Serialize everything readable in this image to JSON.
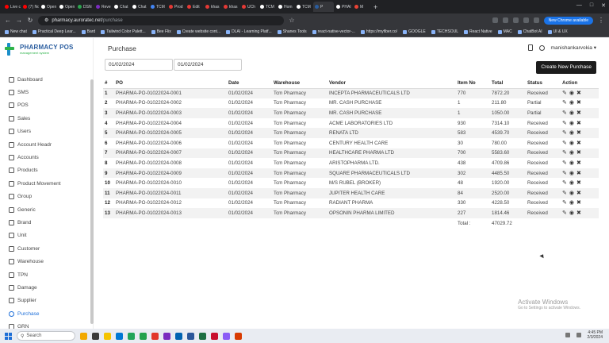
{
  "browser": {
    "tabs": [
      {
        "label": "Live ci",
        "color": "#ff0000"
      },
      {
        "label": "(7) No",
        "color": "#ff0000"
      },
      {
        "label": "Open",
        "color": "#ffffff"
      },
      {
        "label": "Open",
        "color": "#ffffff"
      },
      {
        "label": "DSN",
        "color": "#2da44e"
      },
      {
        "label": "Reve",
        "color": "#7b2cbf"
      },
      {
        "label": "Chat",
        "color": "#ffffff"
      },
      {
        "label": "Chat",
        "color": "#ffffff"
      },
      {
        "label": "TCM",
        "color": "#4285f4"
      },
      {
        "label": "Prod",
        "color": "#e53935"
      },
      {
        "label": "Edit",
        "color": "#e53935"
      },
      {
        "label": "khas",
        "color": "#e53935"
      },
      {
        "label": "khas",
        "color": "#e53935"
      },
      {
        "label": "UCh",
        "color": "#e53935"
      },
      {
        "label": "TCM",
        "color": "#ffffff"
      },
      {
        "label": "Hom",
        "color": "#ffffff"
      },
      {
        "label": "TCM",
        "color": "#ffffff"
      },
      {
        "label": "P",
        "color": "#2a5d9f",
        "active": true
      },
      {
        "label": "PHAI",
        "color": "#ffffff"
      },
      {
        "label": "M",
        "color": "#ea4335"
      }
    ],
    "url_host": "pharmacy.auroratec.net",
    "url_path": "/purchase",
    "new_chrome": "New Chrome available",
    "bookmarks": [
      "New chat",
      "Practical Deep Lear...",
      "Bard",
      "Tailwind Color Palett...",
      "Bee Flix",
      "Create website cont...",
      "DLAI - Learning Platf...",
      "Shanes Tools",
      "react-native-vector-...",
      "https://myfiber.co/",
      "GOOGLE",
      "TECHSOUL",
      "React Native",
      "MAC",
      "ChatBot AI",
      "UI & UX"
    ]
  },
  "app": {
    "logo_title": "PHARMACY POS",
    "logo_sub": "management system",
    "menu": [
      "Dashboard",
      "SMS",
      "POS",
      "Sales",
      "Users",
      "Account Headr",
      "Accounts",
      "Products",
      "Product Movement",
      "Group",
      "Generic",
      "Brand",
      "Unit",
      "Customer",
      "Warehouse",
      "TPN",
      "Damage",
      "Supplier",
      "Purchase",
      "GRN"
    ],
    "active_menu": "Purchase",
    "page_title": "Purchase",
    "username": "manishankarvokia",
    "date_from": "01/02/2024",
    "date_to": "01/02/2024",
    "new_button": "Create New Purchase",
    "columns": [
      "#",
      "PO",
      "Date",
      "Warehouse",
      "Vendor",
      "Item No",
      "Total",
      "Status",
      "Action"
    ],
    "rows": [
      [
        "1",
        "PHARMA-PO-01022024-0001",
        "01/02/2024",
        "Tcm Pharmacy",
        "INCEPTA PHARMACEUTICALS LTD",
        "770",
        "7872.20",
        "Received"
      ],
      [
        "2",
        "PHARMA-PO-01022024-0002",
        "01/02/2024",
        "Tcm Pharmacy",
        "MR. CASH PURCHASE",
        "1",
        "211.80",
        "Partial"
      ],
      [
        "3",
        "PHARMA-PO-01022024-0003",
        "01/02/2024",
        "Tcm Pharmacy",
        "MR. CASH PURCHASE",
        "1",
        "1050.00",
        "Partial"
      ],
      [
        "4",
        "PHARMA-PO-01022024-0004",
        "01/02/2024",
        "Tcm Pharmacy",
        "ACME LABORATORIES LTD",
        "930",
        "7314.10",
        "Received"
      ],
      [
        "5",
        "PHARMA-PO-01022024-0005",
        "01/02/2024",
        "Tcm Pharmacy",
        "RENATA LTD",
        "583",
        "4539.70",
        "Received"
      ],
      [
        "6",
        "PHARMA-PO-01022024-0006",
        "01/02/2024",
        "Tcm Pharmacy",
        "CENTURY HEALTH CARE",
        "30",
        "780.00",
        "Received"
      ],
      [
        "7",
        "PHARMA-PO-01022024-0007",
        "01/02/2024",
        "Tcm Pharmacy",
        "HEALTHCARE PHARMA LTD",
        "700",
        "5583.60",
        "Received"
      ],
      [
        "8",
        "PHARMA-PO-01022024-0008",
        "01/02/2024",
        "Tcm Pharmacy",
        "ARISTOPHARMA LTD.",
        "438",
        "4709.86",
        "Received"
      ],
      [
        "9",
        "PHARMA-PO-01022024-0009",
        "01/02/2024",
        "Tcm Pharmacy",
        "SQUARE PHARMACEUTICALS LTD",
        "302",
        "4485.50",
        "Received"
      ],
      [
        "10",
        "PHARMA-PO-01022024-0010",
        "01/02/2024",
        "Tcm Pharmacy",
        "M/S RUBEL (BROKER)",
        "48",
        "1920.00",
        "Received"
      ],
      [
        "11",
        "PHARMA-PO-01022024-0011",
        "01/02/2024",
        "Tcm Pharmacy",
        "JUPITER HEALTH CARE",
        "84",
        "2520.00",
        "Received"
      ],
      [
        "12",
        "PHARMA-PO-01022024-0012",
        "01/02/2024",
        "Tcm Pharmacy",
        "RADIANT PHARMA",
        "330",
        "4228.50",
        "Received"
      ],
      [
        "13",
        "PHARMA-PO-01022024-0013",
        "01/02/2024",
        "Tcm Pharmacy",
        "OPSONIN PHARMA LIMITED",
        "227",
        "1814.46",
        "Received"
      ]
    ],
    "total_label": "Total :",
    "total_value": "47029.72"
  },
  "watermark": {
    "title": "Activate Windows",
    "sub": "Go to Settings to activate Windows."
  },
  "taskbar": {
    "search": "Search",
    "time": "4:45 PM",
    "date": "2/3/2024",
    "apps": [
      "#f2a900",
      "#3a3a3a",
      "#f5c400",
      "#0078d4",
      "#22a559",
      "#23a24d",
      "#e2372b",
      "#7b2cbf",
      "#0063b1",
      "#2b579a",
      "#1d6f42",
      "#c8102e",
      "#8b5cf6",
      "#d83b01"
    ]
  }
}
